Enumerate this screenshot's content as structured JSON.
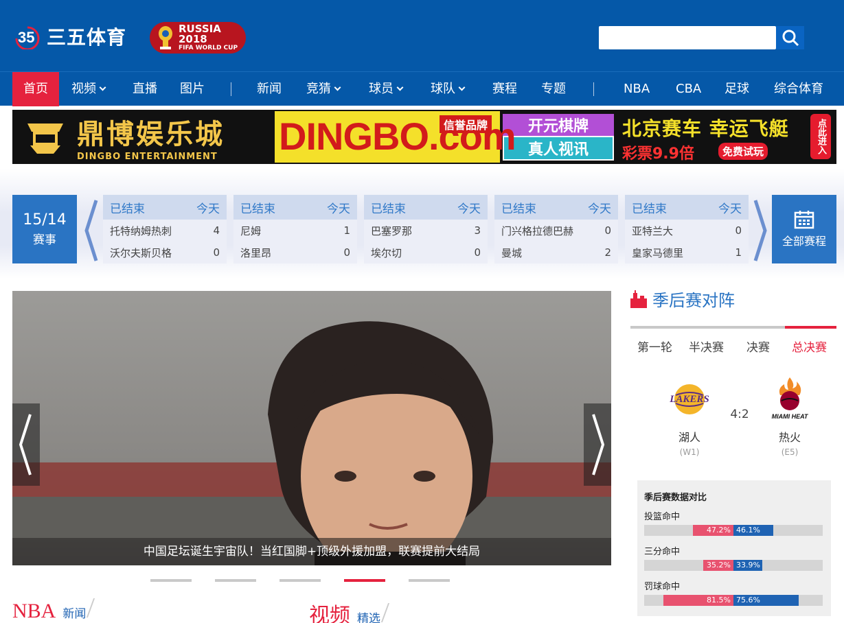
{
  "header": {
    "logo_text": "三五体育",
    "logo_numeral": "35",
    "worldcup_line1": "RUSSIA 2018",
    "worldcup_line2": "FIFA WORLD CUP",
    "search_placeholder": ""
  },
  "nav": {
    "items": [
      {
        "label": "首页",
        "active": true
      },
      {
        "label": "视频",
        "dropdown": true
      },
      {
        "label": "直播"
      },
      {
        "label": "图片"
      },
      {
        "label": "新闻"
      },
      {
        "label": "竞猜",
        "dropdown": true
      },
      {
        "label": "球员",
        "dropdown": true
      },
      {
        "label": "球队",
        "dropdown": true
      },
      {
        "label": "赛程"
      },
      {
        "label": "专题"
      },
      {
        "label": "NBA"
      },
      {
        "label": "CBA"
      },
      {
        "label": "足球"
      },
      {
        "label": "综合体育"
      }
    ]
  },
  "ad": {
    "brand_cn": "鼎博娱乐城",
    "brand_en": "DINGBO ENTERTAINMENT",
    "domain": "DINGBO.com",
    "tag": "信誉品牌",
    "card1": "开元棋牌",
    "card2": "真人视讯",
    "race": "北京赛车 幸运飞艇",
    "lottery": "彩票9.9倍",
    "free": "免费试玩",
    "cta": "点此进入"
  },
  "schedule": {
    "count": "15/14",
    "count_label": "赛事",
    "all_label": "全部赛程",
    "matches": [
      {
        "status": "已结束",
        "day": "今天",
        "home": "托特纳姆热刺",
        "home_score": "4",
        "away": "沃尔夫斯贝格",
        "away_score": "0"
      },
      {
        "status": "已结束",
        "day": "今天",
        "home": "尼姆",
        "home_score": "1",
        "away": "洛里昂",
        "away_score": "0"
      },
      {
        "status": "已结束",
        "day": "今天",
        "home": "巴塞罗那",
        "home_score": "3",
        "away": "埃尔切",
        "away_score": "0"
      },
      {
        "status": "已结束",
        "day": "今天",
        "home": "门兴格拉德巴赫",
        "home_score": "0",
        "away": "曼城",
        "away_score": "2"
      },
      {
        "status": "已结束",
        "day": "今天",
        "home": "亚特兰大",
        "home_score": "0",
        "away": "皇家马德里",
        "away_score": "1"
      }
    ]
  },
  "slider": {
    "caption": "中国足坛诞生宇宙队！当红国脚+顶级外援加盟，联赛提前大结局",
    "active_index": 3,
    "dot_count": 5
  },
  "sections": {
    "nba_big": "NBA",
    "nba_small": "新闻",
    "video_big": "视频",
    "video_small": "精选"
  },
  "playoffs": {
    "title": "季后赛对阵",
    "tabs": [
      {
        "label": "第一轮"
      },
      {
        "label": "半决赛"
      },
      {
        "label": "决赛"
      },
      {
        "label": "总决赛",
        "active": true
      }
    ],
    "home": {
      "name": "湖人",
      "seed": "(W1)",
      "logo_text": "LAKERS"
    },
    "away": {
      "name": "热火",
      "seed": "(E5)",
      "logo_text": "MIAMI HEAT"
    },
    "score": "4:2",
    "stats_title": "季后赛数据对比",
    "stats": [
      {
        "label": "投篮命中",
        "left": "47.2%",
        "right": "46.1%",
        "left_value": 47.2,
        "right_value": 46.1
      },
      {
        "label": "三分命中",
        "left": "35.2%",
        "right": "33.9%",
        "left_value": 35.2,
        "right_value": 33.9
      },
      {
        "label": "罚球命中",
        "left": "81.5%",
        "right": "75.6%",
        "left_value": 81.5,
        "right_value": 75.6
      }
    ]
  },
  "colors": {
    "header_blue": "#0558a8",
    "accent_red": "#e5223e",
    "schedule_blue": "#2a74c3"
  }
}
